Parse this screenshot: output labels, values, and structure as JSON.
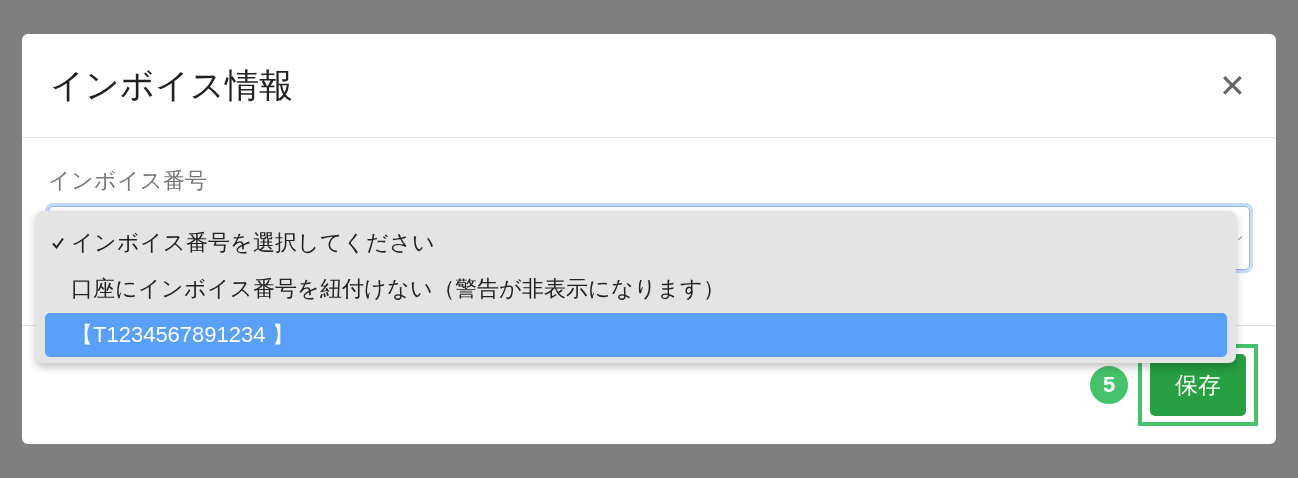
{
  "dialog": {
    "title": "インボイス情報",
    "close": "✕"
  },
  "field": {
    "label": "インボイス番号"
  },
  "dropdown": {
    "options": [
      {
        "text": "インボイス番号を選択してください",
        "checked": true,
        "selected": false
      },
      {
        "text": "口座にインボイス番号を紐付けない（警告が非表示になります）",
        "checked": false,
        "selected": false
      },
      {
        "text": "【T1234567891234 】",
        "checked": false,
        "selected": true
      }
    ]
  },
  "footer": {
    "step_badge": "5",
    "save_button": "保存"
  }
}
